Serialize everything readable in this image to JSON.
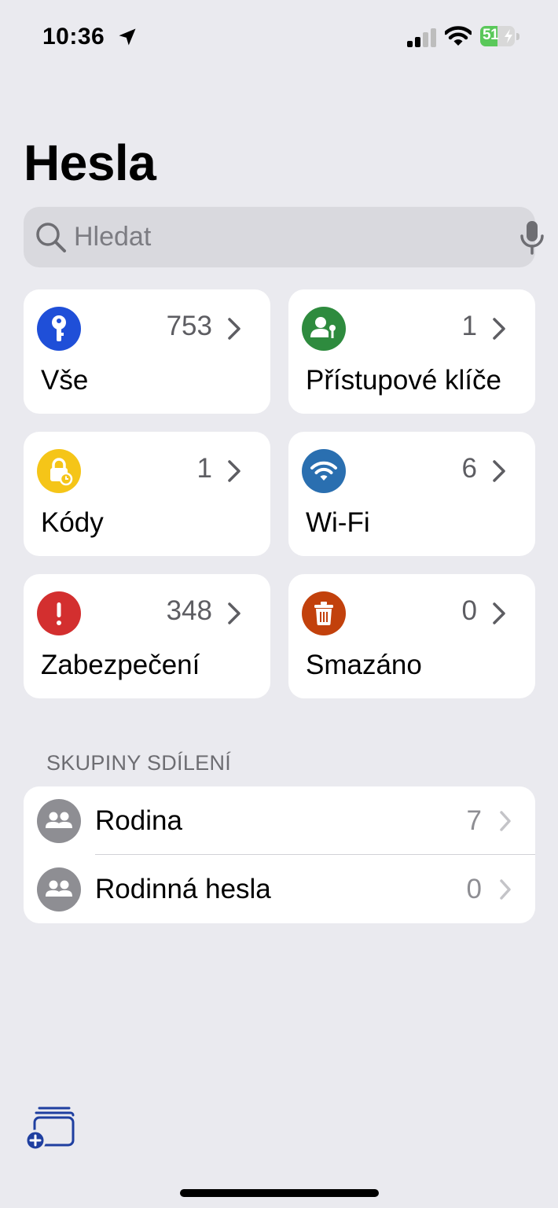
{
  "status_bar": {
    "time": "10:36",
    "battery_percent": "51",
    "battery_level": 0.51
  },
  "header": {
    "title": "Hesla"
  },
  "search": {
    "placeholder": "Hledat"
  },
  "categories": [
    {
      "label": "Vše",
      "count": "753",
      "icon": "key-icon",
      "color": "#1f4fd8"
    },
    {
      "label": "Přístupové klíče",
      "count": "1",
      "icon": "person-key-icon",
      "color": "#2e8b3e"
    },
    {
      "label": "Kódy",
      "count": "1",
      "icon": "lock-clock-icon",
      "color": "#f5c518"
    },
    {
      "label": "Wi-Fi",
      "count": "6",
      "icon": "wifi-icon",
      "color": "#2a6fb0"
    },
    {
      "label": "Zabezpečení",
      "count": "348",
      "icon": "exclamation-icon",
      "color": "#d32f2f"
    },
    {
      "label": "Smazáno",
      "count": "0",
      "icon": "trash-icon",
      "color": "#c2410c"
    }
  ],
  "sharing_groups": {
    "header": "SKUPINY SDÍLENÍ",
    "items": [
      {
        "name": "Rodina",
        "count": "7",
        "icon": "people-icon"
      },
      {
        "name": "Rodinná hesla",
        "count": "0",
        "icon": "people-icon"
      }
    ]
  },
  "colors": {
    "accent": "#1f3fa0",
    "background": "#eaeaef",
    "card": "#ffffff"
  }
}
